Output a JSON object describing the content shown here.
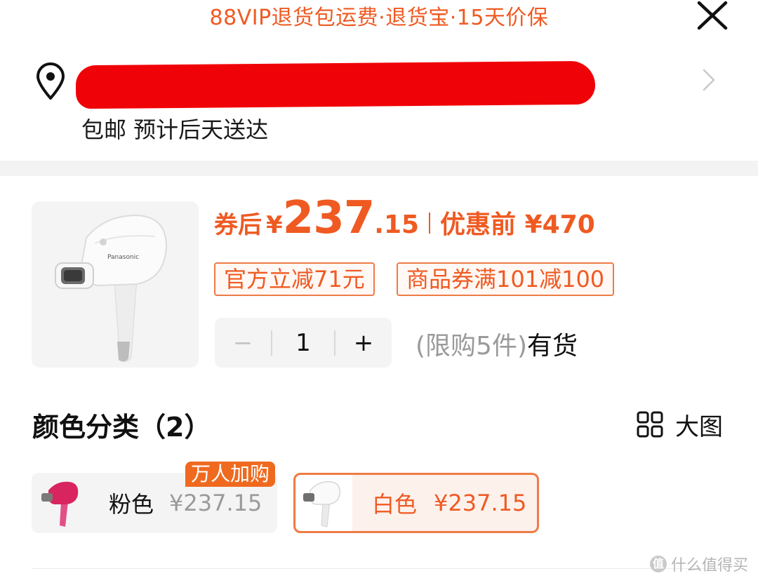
{
  "banner": {
    "text": "88VIP退货包运费·退货宝·15天价保"
  },
  "address": {
    "shipping_text": "包邮 预计后天送达"
  },
  "product": {
    "price_prefix": "券后",
    "currency": "¥",
    "price_integer": "237",
    "price_decimal": ".15",
    "price_before_label": "优惠前 ¥470",
    "tags": [
      "官方立减71元",
      "商品券满101减100"
    ],
    "quantity": {
      "minus": "−",
      "value": "1",
      "plus": "+"
    },
    "limit_text": "(限购5件)",
    "stock_text": "有货"
  },
  "color_section": {
    "title": "颜色分类（2）",
    "big_image_label": "大图",
    "options": [
      {
        "name": "粉色",
        "price": "¥237.15",
        "badge": "万人加购",
        "selected": false
      },
      {
        "name": "白色",
        "price": "¥237.15",
        "selected": true
      }
    ]
  },
  "watermark": {
    "text": "什么值得买",
    "logo": "值"
  },
  "colors": {
    "accent": "#ef5a22",
    "tag_border": "#ef7b45",
    "badge_bg": "#ef6a1f",
    "redaction": "#f00308"
  },
  "icons": [
    "close-icon",
    "location-pin-icon",
    "chevron-right-icon",
    "grid-icon"
  ]
}
